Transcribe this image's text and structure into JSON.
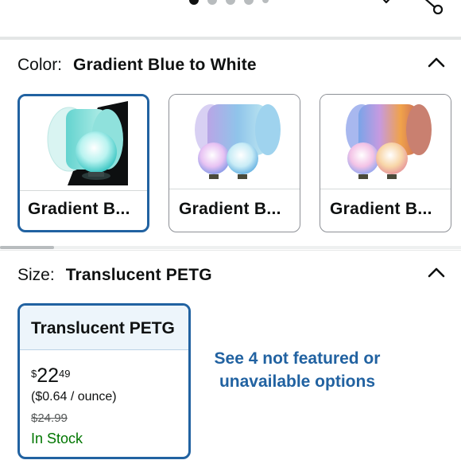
{
  "carousel": {
    "dot_count": 5,
    "active_index": 0
  },
  "color_section": {
    "key": "Color:",
    "value": "Gradient Blue to White",
    "options": [
      {
        "label": "Gradient B...",
        "selected": true,
        "image": "cyan-filament-spool-with-glowing-moon-lamp"
      },
      {
        "label": "Gradient B...",
        "selected": false,
        "image": "purple-blue-filament-spools-with-moon-lamps"
      },
      {
        "label": "Gradient B...",
        "selected": false,
        "image": "rainbow-filament-spools-with-moon-lamps"
      }
    ]
  },
  "size_section": {
    "key": "Size:",
    "value": "Translucent PETG",
    "option": {
      "label": "Translucent PETG",
      "price_symbol": "$",
      "price_whole": "22",
      "price_fraction": "49",
      "unit_price": "($0.64 / ounce)",
      "list_price": "$24.99",
      "availability": "In Stock"
    },
    "more_options": "See 4 not featured or unavailable options"
  },
  "colors": {
    "accent": "#2162a1",
    "in_stock": "#007600",
    "text": "#0f1111"
  }
}
